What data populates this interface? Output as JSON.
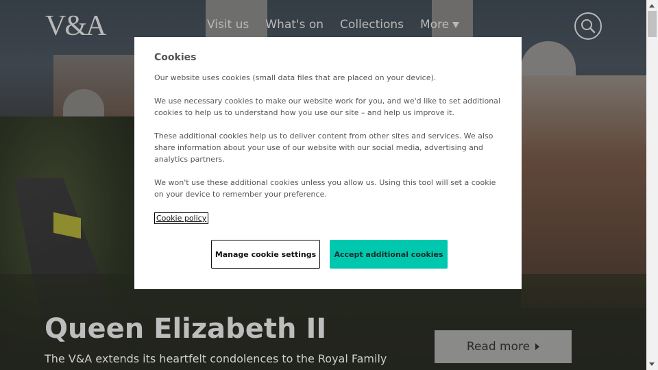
{
  "header": {
    "logo": "V&A",
    "nav": [
      "Visit us",
      "What's on",
      "Collections",
      "More"
    ],
    "search_icon": "search-icon"
  },
  "hero": {
    "title": "Queen Elizabeth II",
    "subtitle": "The V&A extends its heartfelt condolences to the Royal Family",
    "read_more": "Read more"
  },
  "cookie_modal": {
    "title": "Cookies",
    "paragraphs": [
      "Our website uses cookies (small data files that are placed on your device).",
      "We use necessary cookies to make our website work for you, and we'd like to set additional cookies to help us to understand how you use our site – and help us improve it.",
      "These additional cookies help us to deliver content from other sites and services. We also share information about your use of our website with our social media, advertising and analytics partners.",
      "We won't use these additional cookies unless you allow us. Using this tool will set a cookie on your device to remember your preference."
    ],
    "policy_link": "Cookie policy",
    "manage_button": "Manage cookie settings",
    "accept_button": "Accept additional cookies",
    "accent_color": "#00c8ae"
  }
}
